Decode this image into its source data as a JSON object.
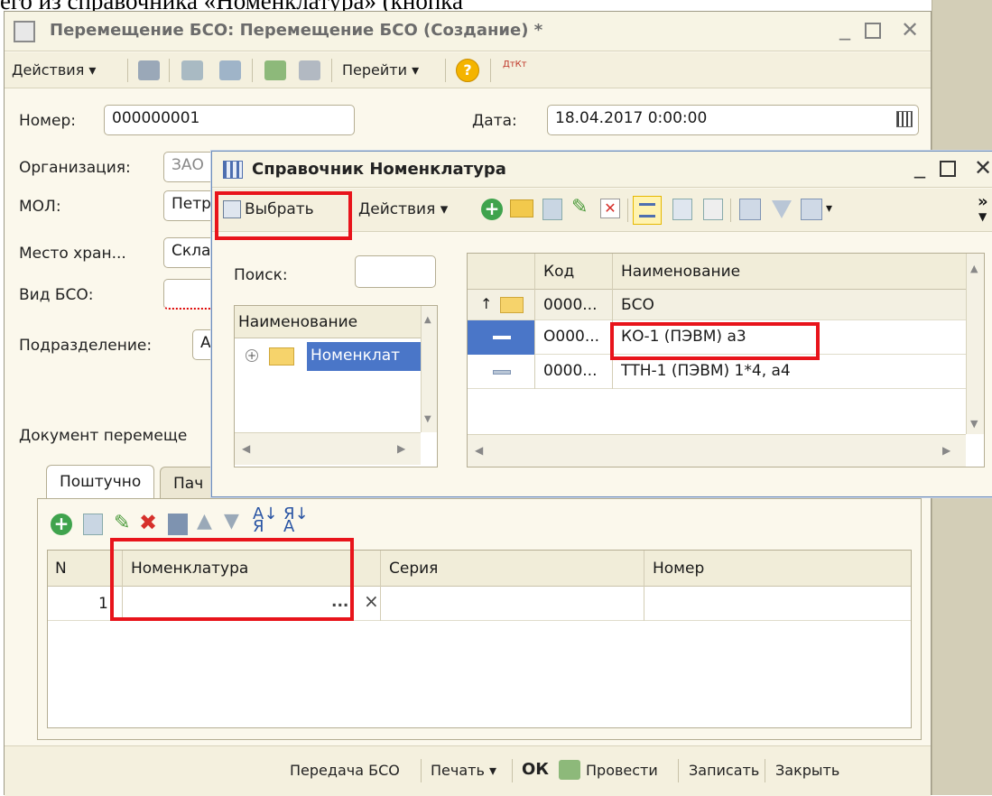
{
  "top_partial_text": "его из справочника «Номенклатура» (кнопка",
  "main_window": {
    "title": "Перемещение БСО: Перемещение БСО (Создание) *",
    "toolbar": {
      "actions_label": "Действия ▾",
      "goto_label": "Перейти ▾",
      "help_label": "?",
      "dtkt_label": "ДтКт"
    },
    "fields": {
      "number_label": "Номер:",
      "number_value": "000000001",
      "date_label": "Дата:",
      "date_value": "18.04.2017  0:00:00",
      "org_label": "Организация:",
      "org_value": "ЗАО",
      "mol_label": "МОЛ:",
      "mol_value": "Петр",
      "place_label": "Место хран...",
      "place_value": "Скла",
      "bso_type_label": "Вид БСО:",
      "division_label": "Подразделение:",
      "division_value": "А",
      "doc_label": "Документ перемеще"
    },
    "tabs": [
      {
        "label": "Поштучно"
      },
      {
        "label": "Пач"
      }
    ],
    "grid": {
      "headers": [
        "N",
        "Номенклатура",
        "Серия",
        "Номер"
      ],
      "rows": [
        {
          "n": "1",
          "nomenclature": "",
          "series": "",
          "number": ""
        }
      ],
      "ellipsis": "...",
      "clear": "×"
    },
    "status_bar": {
      "transfer": "Передача БСО",
      "print": "Печать ▾",
      "ok": "ОК",
      "post": "Провести",
      "save": "Записать",
      "close": "Закрыть"
    }
  },
  "dialog": {
    "title": "Справочник Номенклатура",
    "select_label": "Выбрать",
    "actions_label": "Действия ▾",
    "overflow": "»",
    "search_label": "Поиск:",
    "tree_header": "Наименование",
    "tree_item": "Номенклат",
    "list_headers": [
      "Код",
      "Наименование"
    ],
    "list_rows": [
      {
        "code": "0000...",
        "name": "БСО"
      },
      {
        "code": "O000...",
        "name": "КО-1 (ПЭВМ)  а3"
      },
      {
        "code": "0000...",
        "name": "ТТН-1 (ПЭВМ) 1*4, а4"
      }
    ]
  },
  "colors": {
    "highlight": "#e8141b",
    "selection": "#4a76c8",
    "window_bg": "#fbf8ec"
  }
}
